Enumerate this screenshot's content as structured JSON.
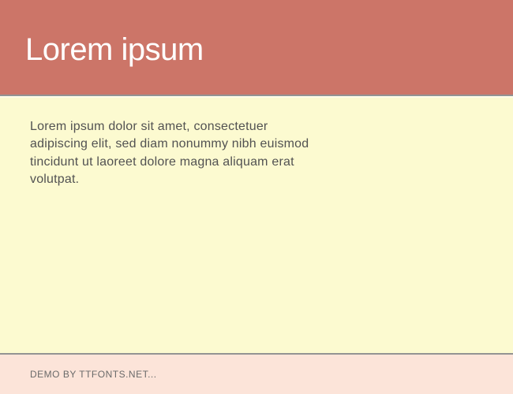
{
  "header": {
    "title": "Lorem ipsum"
  },
  "content": {
    "body": "Lorem ipsum dolor sit amet, consectetuer adipiscing elit, sed diam nonummy nibh euismod tincidunt ut laoreet dolore magna aliquam erat volutpat."
  },
  "footer": {
    "credit": "DEMO BY TTFONTS.NET..."
  }
}
